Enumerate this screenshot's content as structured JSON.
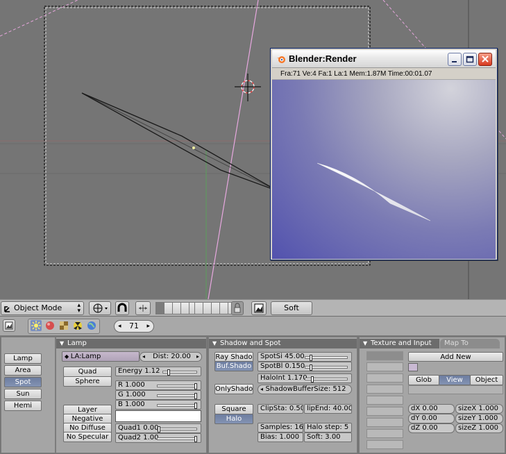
{
  "render_window": {
    "title": "Blender:Render",
    "status": "Fra:71  Ve:4 Fa:1 La:1 Mem:1.87M Time:00:01.07"
  },
  "header": {
    "mode_label": "Object Mode",
    "shading_label": "Soft"
  },
  "buttons_header": {
    "frame": "71"
  },
  "lamp_panel": {
    "title": "Lamp",
    "types": [
      "Lamp",
      "Area",
      "Spot",
      "Sun",
      "Hemi"
    ],
    "selected_type": "Spot",
    "name_field": "LA:Lamp",
    "dist": "Dist: 20.00",
    "quad_label": "Quad",
    "sphere_label": "Sphere",
    "energy": "Energy 1.12",
    "r": "R 1.000",
    "g": "G 1.000",
    "b": "B 1.000",
    "layer_label": "Layer",
    "negative_label": "Negative",
    "no_diffuse_label": "No Diffuse",
    "no_specular_label": "No Specular",
    "quad1": "Quad1 0.00",
    "quad2": "Quad2 1.00",
    "color_swatch": "#ffffff"
  },
  "shadow_panel": {
    "title": "Shadow and Spot",
    "ray_shadow_label": "Ray Shado",
    "buf_shadow_label": "Buf.Shado",
    "only_shadow_label": "OnlyShado",
    "square_label": "Square",
    "halo_label": "Halo",
    "spot_si": "SpotSi 45.00",
    "spot_bl": "SpotBl 0.150",
    "halo_int": "HaloInt 1.170",
    "shadow_buffer_size": "ShadowBufferSize: 512",
    "clip_sta": "ClipSta: 0.50",
    "clip_end": "lipEnd: 40.00",
    "samples": "Samples: 16",
    "halo_step": "Halo step: 5",
    "bias": "Bias: 1.000",
    "soft": "Soft: 3.00"
  },
  "texture_panel": {
    "tab_active": "Texture and Input",
    "tab_inactive": "Map To",
    "add_new_label": "Add New",
    "glob_label": "Glob",
    "view_label": "View",
    "object_label": "Object",
    "dx": "dX 0.00",
    "dy": "dY 0.00",
    "dz": "dZ 0.00",
    "size_x": "sizeX 1.000",
    "size_y": "sizeY 1.000",
    "size_z": "sizeZ 1.000"
  },
  "colors": {
    "viewport_bg": "#757575",
    "panel_bg": "#a5a5a5",
    "selected_button": "#7080a4",
    "render_sky": "#5252ae"
  }
}
